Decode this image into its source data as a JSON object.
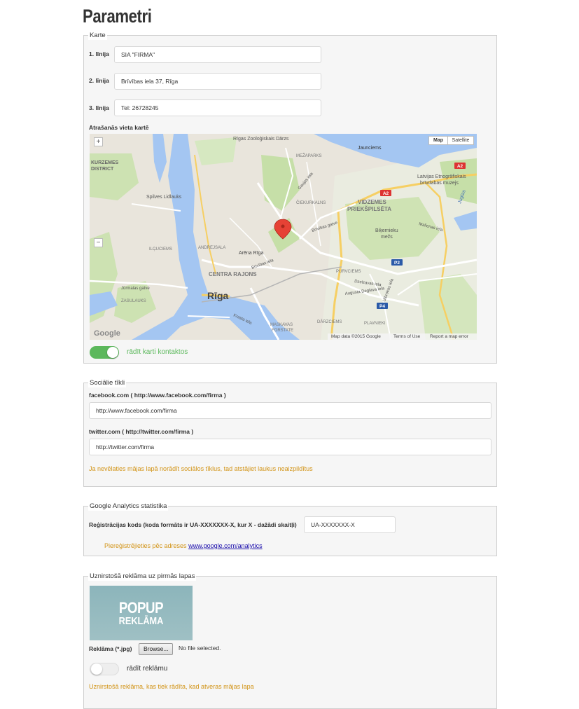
{
  "page": {
    "title": "Parametri"
  },
  "map_section": {
    "legend": "Karte",
    "lines": [
      {
        "label": "1. līnija",
        "value": "SIA \"FIRMA\""
      },
      {
        "label": "2. līnija",
        "value": "Brīvības iela 37, Rīga"
      },
      {
        "label": "3. līnija",
        "value": "Tel: 26728245"
      }
    ],
    "map_label": "Atrašanās vieta kartē",
    "map": {
      "type_buttons": [
        "Map",
        "Satellite"
      ],
      "active_type": "Map",
      "zoom_in": "+",
      "zoom_out": "−",
      "place_labels": {
        "zoo": "Rīgas Zooloģiskais Dārzs",
        "jaunciems": "Jaunciems",
        "mezaparks": "MEŽAPARKS",
        "kurzeme": "KURZEMES",
        "district": "DISTRICT",
        "spilve": "Spilves Lidlauks",
        "ciekurkalns": "ČIEKURKALNS",
        "vidzemes1": "VIDZEMES",
        "vidzemes2": "PRIEKŠPILSĒTA",
        "ethno1": "Latvijas Etnogrāfiskais",
        "ethno2": "brīvdabas muzejs",
        "bikernieku1": "Biķernieku",
        "bikernieku2": "mežs",
        "andrejsala": "ANDREJSALA",
        "arena": "Arēna Rīga",
        "centra": "CENTRA RAJONS",
        "riga": "Rīga",
        "purvciems": "PURVCIEMS",
        "zasulauks": "ZASULAUKS",
        "darzciems": "DĀRZCIEMS",
        "plavnieki": "PLAVNIEKI",
        "maskavas1": "MASKAVAS",
        "maskavas2": "FORSTATE",
        "juglas": "Juglas",
        "ilguciems": "ILĢUCIEMS"
      },
      "road_labels": {
        "brivibas": "Brīvības gatve",
        "brivibas_iela": "Brīvības iela",
        "augusta": "Augusta Deglava iela",
        "dzelzavas": "Dzelzavas iela",
        "krasta": "Krasta iela",
        "jurmalas": "Jūrmalas gatve",
        "ulbrokas": "Ulbrokas iela",
        "mellenes": "Malienas iela",
        "gaujas": "Gaujas iela"
      },
      "shields": {
        "a2_top": "A2",
        "a2_mid": "A2",
        "p2": "P2",
        "p4": "P4"
      },
      "google": "Google",
      "attribution": {
        "data": "Map data ©2015 Google",
        "terms": "Terms of Use",
        "report": "Report a map error"
      }
    },
    "show_map_toggle": {
      "label": "rādīt karti kontaktos",
      "on": true
    }
  },
  "social_section": {
    "legend": "Sociālie tīkli",
    "facebook_label": "facebook.com ( http://www.facebook.com/firma )",
    "facebook_value": "http://www.facebook.com/firma",
    "twitter_label": "twitter.com ( http://twitter.com/firma )",
    "twitter_value": "http://twitter.com/firma",
    "hint": "Ja nevēlaties mājas lapā norādīt sociālos tīklus, tad atstājiet laukus neaizpildītus"
  },
  "analytics_section": {
    "legend": "Google Analytics statistika",
    "code_label": "Reģistrācijas kods (koda formāts ir UA-XXXXXXX-X, kur X - dažādi skaitļi)",
    "code_value": "UA-XXXXXXX-X",
    "register_text": "Piereģistrējieties pēc adreses",
    "register_link": "www.google.com/analytics"
  },
  "popup_section": {
    "legend": "Uznirstošā reklāma uz pirmās lapas",
    "image_line1": "POPUP",
    "image_line2": "REKLĀMA",
    "file_label": "Reklāma (*.jpg)",
    "browse_label": "Browse...",
    "file_status": "No file selected.",
    "show_toggle": {
      "label": "rādīt reklāmu",
      "on": false
    },
    "hint": "Uznirstošā reklāma, kas tiek rādīta, kad atveras mājas lapa"
  },
  "colors": {
    "accent_green": "#5cb85c",
    "hint_orange": "#d29417",
    "link_blue": "#1a0dab"
  }
}
